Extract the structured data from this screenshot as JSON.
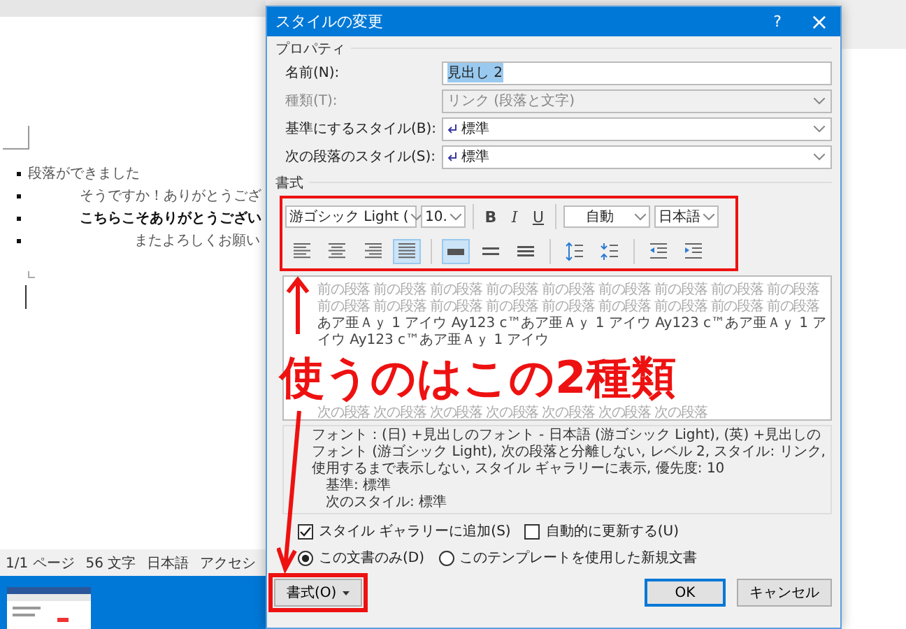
{
  "document": {
    "lines": [
      {
        "text": "段落ができました",
        "kind": "normal"
      },
      {
        "text": "そうですか！ありがとうござ",
        "kind": "indented"
      },
      {
        "text": "こちらこそありがとうござい",
        "kind": "bold"
      },
      {
        "text": "またよろしくお願い",
        "kind": "far"
      }
    ]
  },
  "status_bar": [
    "1/1 ページ",
    "56 文字",
    "日本語",
    "アクセシ"
  ],
  "dialog": {
    "title": "スタイルの変更",
    "help": "?",
    "close": "×",
    "properties": {
      "heading": "プロパティ",
      "fields": [
        {
          "label": "名前(N):",
          "value": "見出し 2",
          "kind": "text",
          "disabled": false,
          "value_selected": true
        },
        {
          "label": "種類(T):",
          "value": "リンク (段落と文字)",
          "kind": "combo",
          "disabled": true,
          "value_selected": false
        },
        {
          "label": "基準にするスタイル(B):",
          "value": "標準",
          "kind": "style",
          "disabled": false,
          "value_selected": false
        },
        {
          "label": "次の段落のスタイル(S):",
          "value": "標準",
          "kind": "style",
          "disabled": false,
          "value_selected": false
        }
      ]
    },
    "format": {
      "heading": "書式",
      "font": "游ゴシック Light (",
      "size": "10.",
      "font_color_label": "自動",
      "language": "日本語",
      "styles": [
        {
          "label": "B",
          "kind": "bold"
        },
        {
          "label": "I",
          "kind": "italic"
        },
        {
          "label": "U",
          "kind": "underline"
        }
      ],
      "align": [
        {
          "kind": "left",
          "selected": false
        },
        {
          "kind": "center",
          "selected": false
        },
        {
          "kind": "right",
          "selected": false
        },
        {
          "kind": "justify",
          "selected": true
        }
      ],
      "spacing": [
        {
          "kind": "single",
          "selected": true
        },
        {
          "kind": "onehalf",
          "selected": false
        },
        {
          "kind": "double",
          "selected": false
        }
      ],
      "paragraph": [
        {
          "kind": "line-spacing"
        },
        {
          "kind": "para-spacing"
        }
      ],
      "indent": [
        {
          "kind": "decrease"
        },
        {
          "kind": "increase"
        }
      ]
    },
    "preview": {
      "previous": [
        "前の段落 前の段落 前の段落 前の段落 前の段落 前の段落 前の段落 前の段落 前の段落",
        "前の段落 前の段落 前の段落 前の段落 前の段落 前の段落 前の段落 前の段落 前の段落"
      ],
      "sample": "あア亜Ａｙ 1 アイウ Ay123 c™あア亜Ａｙ 1 アイウ Ay123 c™あア亜Ａｙ 1 アイウ Ay123 c™あア亜Ａｙ 1 アイウ",
      "next": "次の段落 次の段落 次の段落 次の段落 次の段落 次の段落 次の段落"
    },
    "description": [
      "フォント：(日) +見出しのフォント - 日本語 (游ゴシック Light), (英) +見出しのフォント (游ゴシック Light), 次の段落と分離しない, レベル 2, スタイル: リンク, 使用するまで表示しない, スタイル ギャラリーに表示, 優先度: 10",
      "基準: 標準",
      "次のスタイル: 標準"
    ],
    "options": [
      {
        "kind": "checkbox",
        "label": "スタイル ギャラリーに追加(S)",
        "checked": true
      },
      {
        "kind": "checkbox",
        "label": "自動的に更新する(U)",
        "checked": false
      }
    ],
    "scope": [
      {
        "label": "この文書のみ(D)",
        "selected": true
      },
      {
        "label": "このテンプレートを使用した新規文書",
        "selected": false
      }
    ],
    "buttons": {
      "format": "書式(O)",
      "ok": "OK",
      "cancel": "キャンセル"
    }
  },
  "annotation": {
    "text": "使うのはこの2種類"
  }
}
